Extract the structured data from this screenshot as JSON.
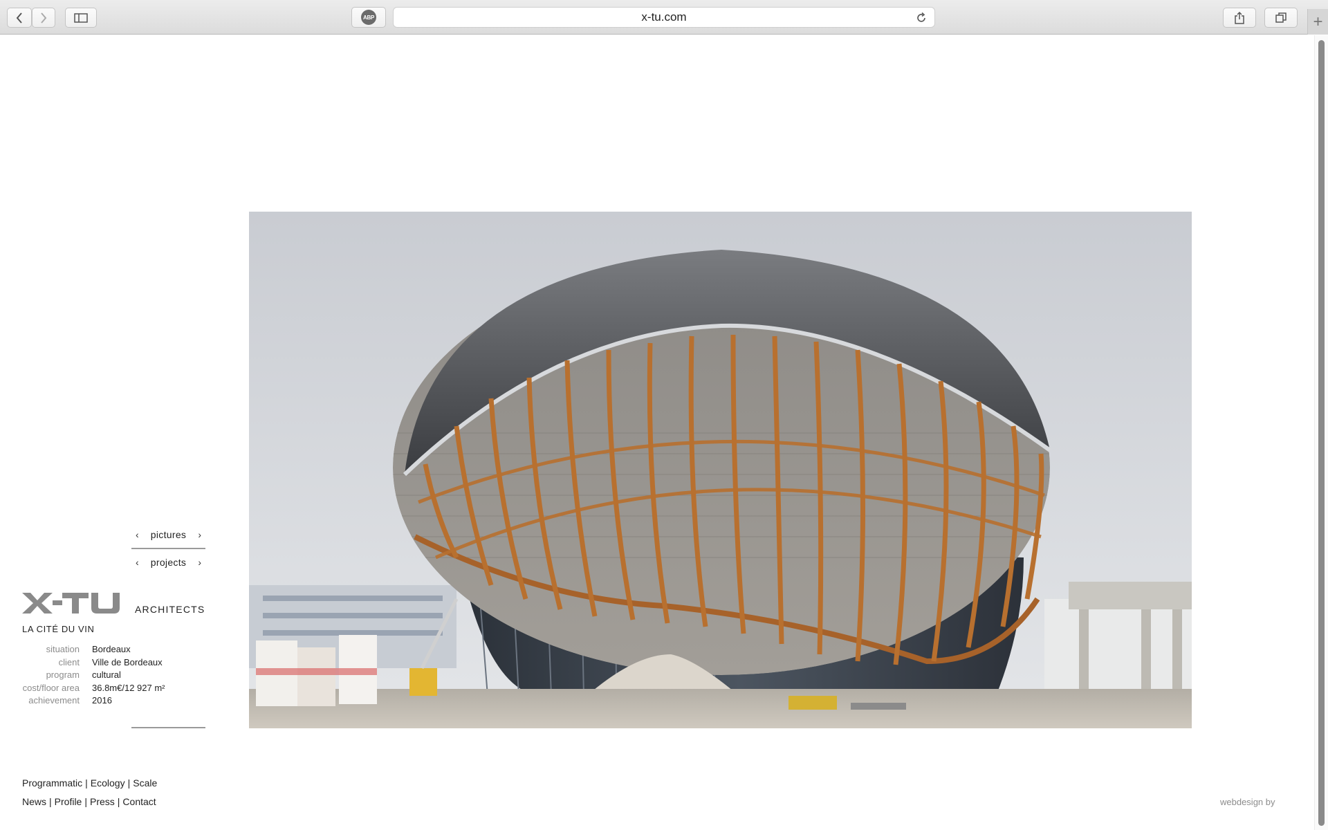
{
  "browser": {
    "url": "x-tu.com",
    "adblock_label": "ABP"
  },
  "nav": {
    "pictures_label": "pictures",
    "projects_label": "projects",
    "prev_glyph": "‹",
    "next_glyph": "›"
  },
  "brand": {
    "logo_text": "X-TU",
    "architects": "ARCHITECTS"
  },
  "project": {
    "title": "LA CITÉ DU VIN",
    "facts": [
      {
        "key": "situation",
        "value": "Bordeaux"
      },
      {
        "key": "client",
        "value": "Ville de Bordeaux"
      },
      {
        "key": "program",
        "value": "cultural"
      },
      {
        "key": "cost/floor area",
        "value": "36.8m€/12 927 m²"
      },
      {
        "key": "achievement",
        "value": "2016"
      }
    ]
  },
  "footer": {
    "row1": [
      "Programmatic",
      "Ecology",
      "Scale"
    ],
    "row2": [
      "News",
      "Profile",
      "Press",
      "Contact"
    ],
    "separator": "|",
    "credit": "webdesign by"
  },
  "colors": {
    "accent_gray": "#8c8c8c",
    "text": "#222222",
    "timber": "#b86a26",
    "sky": "#d4d7dc"
  },
  "icons": [
    "back-arrow-icon",
    "forward-arrow-icon",
    "sidebar-icon",
    "reload-icon",
    "share-icon",
    "tabs-icon",
    "new-tab-icon"
  ]
}
